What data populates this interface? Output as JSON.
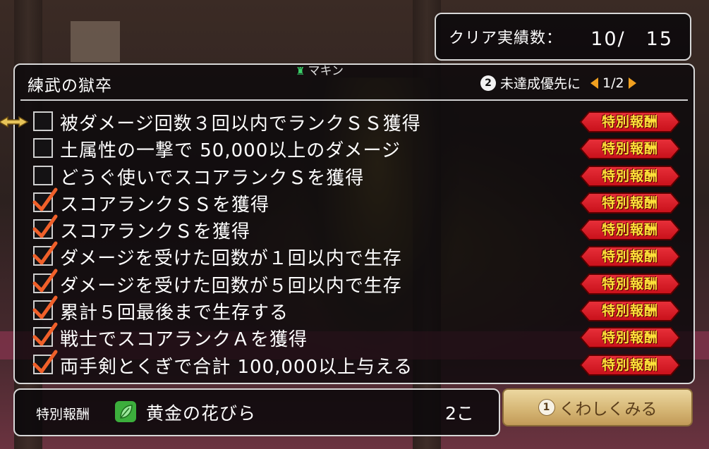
{
  "counter": {
    "label": "クリア実績数：",
    "value": "10/　15"
  },
  "panel": {
    "title": "練武の獄卒",
    "nameplate": "マキン",
    "sort_button_num": "2",
    "sort_label": "未達成優先に",
    "page": "1/2"
  },
  "achievements": [
    {
      "text": "被ダメージ回数３回以内でランクＳＳ獲得",
      "checked": false,
      "reward": "特別報酬"
    },
    {
      "text": "土属性の一撃で 50,000以上のダメージ",
      "checked": false,
      "reward": "特別報酬"
    },
    {
      "text": "どうぐ使いでスコアランクＳを獲得",
      "checked": false,
      "reward": "特別報酬"
    },
    {
      "text": "スコアランクＳＳを獲得",
      "checked": true,
      "reward": "特別報酬"
    },
    {
      "text": "スコアランクＳを獲得",
      "checked": true,
      "reward": "特別報酬"
    },
    {
      "text": "ダメージを受けた回数が１回以内で生存",
      "checked": true,
      "reward": "特別報酬"
    },
    {
      "text": "ダメージを受けた回数が５回以内で生存",
      "checked": true,
      "reward": "特別報酬"
    },
    {
      "text": "累計５回最後まで生存する",
      "checked": true,
      "reward": "特別報酬"
    },
    {
      "text": "戦士でスコアランクＡを獲得",
      "checked": true,
      "reward": "特別報酬"
    },
    {
      "text": "両手剣とくぎで合計 100,000以上与える",
      "checked": true,
      "reward": "特別報酬"
    }
  ],
  "reward_panel": {
    "label": "特別報酬",
    "icon": "leaf-icon",
    "item": "黄金の花びら",
    "quantity": "2こ"
  },
  "detail_button": {
    "num": "1",
    "label": "くわしくみる"
  },
  "colors": {
    "badge_red": "#c8101a",
    "badge_text": "#ffe23a",
    "check": "#f0602a",
    "sort_arrow": "#f0a020"
  }
}
